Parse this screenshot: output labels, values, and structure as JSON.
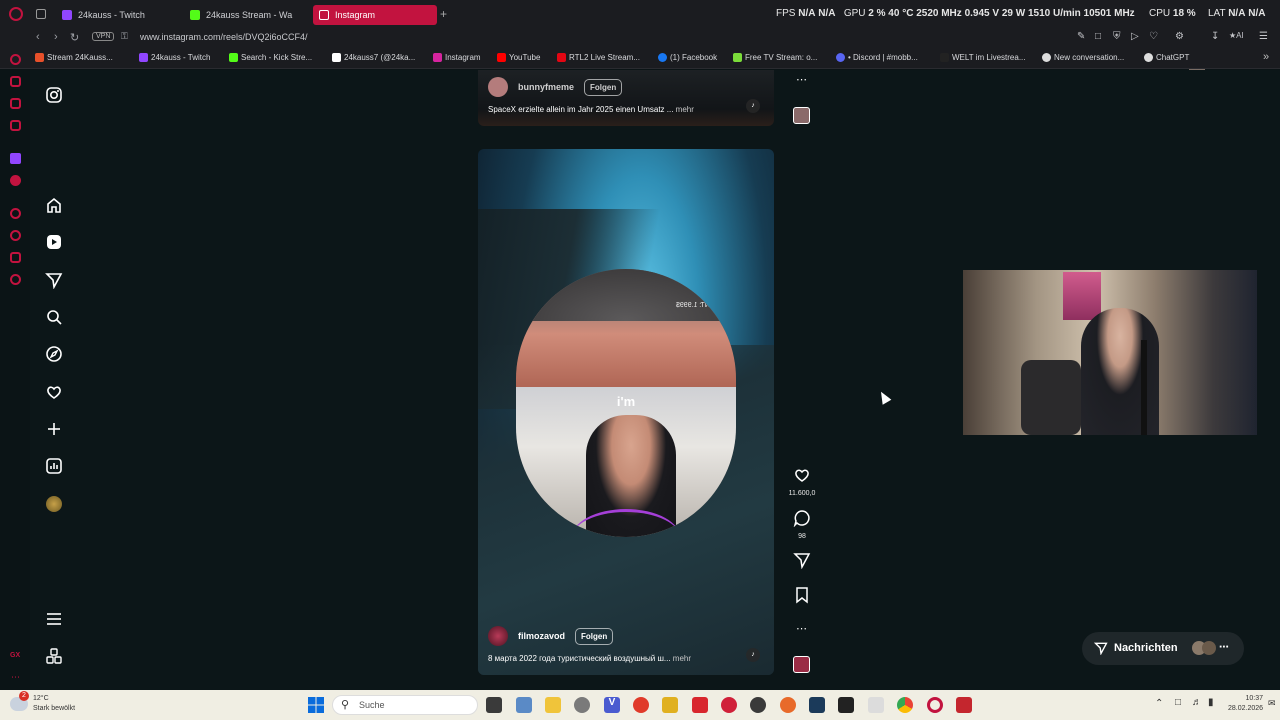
{
  "tabs": [
    {
      "label": "24kauss - Twitch",
      "icon": "twitch-icon",
      "color": "#9146ff"
    },
    {
      "label": "24kauss Stream - Wa",
      "icon": "kick-icon",
      "color": "#53fc18"
    },
    {
      "label": "Instagram",
      "icon": "instagram-icon",
      "color": "#ffffff",
      "active": true
    }
  ],
  "stats": {
    "fps_label": "FPS",
    "fps_value": "N/A",
    "fps_value2": "N/A",
    "gpu_label": "GPU",
    "gpu_load": "2 %",
    "gpu_temp": "40 °C",
    "gpu_clock": "2520 MHz",
    "gpu_volt": "0.945 V",
    "gpu_power": "29 W",
    "gpu_fan": "1510 U/min",
    "gpu_mem": "10501 MHz",
    "cpu_label": "CPU",
    "cpu_load": "18 %",
    "lat_label": "LAT",
    "lat_value": "N/A",
    "lat_value2": "N/A"
  },
  "address": {
    "vpn": "VPN",
    "url": "www.instagram.com/reels/DVQ2i6oCCF4/"
  },
  "bookmarks": [
    {
      "label": "Stream 24Kauss...",
      "color": "#e8502a"
    },
    {
      "label": "24kauss - Twitch",
      "color": "#9146ff"
    },
    {
      "label": "Search - Kick Stre...",
      "color": "#53fc18"
    },
    {
      "label": "24kauss7 (@24ka...",
      "color": "#ffffff"
    },
    {
      "label": "Instagram",
      "color": "#d6249f"
    },
    {
      "label": "YouTube",
      "color": "#ff0000"
    },
    {
      "label": "RTL2 Live Stream...",
      "color": "#e30613"
    },
    {
      "label": "(1) Facebook",
      "color": "#1877f2"
    },
    {
      "label": "Free TV Stream: o...",
      "color": "#7bdc3a"
    },
    {
      "label": "• Discord | #mobb...",
      "color": "#5865f2"
    },
    {
      "label": "WELT im Livestrea...",
      "color": "#222222"
    },
    {
      "label": "New conversation...",
      "color": "#dddddd"
    },
    {
      "label": "ChatGPT",
      "color": "#dddddd"
    }
  ],
  "reel_top": {
    "username": "bunnyfmeme",
    "follow": "Folgen",
    "caption": "SpaceX erzielte allein im Jahr 2025 einen Umsatz ...",
    "more": "mehr"
  },
  "reel_main": {
    "username": "filmozavod",
    "follow": "Folgen",
    "caption": "8 марта 2022 года туристический воздушный ш...",
    "more": "mehr",
    "overlay_word": "i'm",
    "mirror_text": "NT: 1.999$",
    "likes": "11.600,0",
    "comments": "98"
  },
  "messages": {
    "label": "Nachrichten"
  },
  "taskbar": {
    "weather_temp": "12°C",
    "weather_desc": "Stark bewölkt",
    "search_placeholder": "Suche",
    "time": "10:37",
    "date": "28.02.2026",
    "notif_count": "2"
  },
  "colors": {
    "accent": "#c2133f",
    "page_bg": "#0c1618",
    "taskbar": "#f0eee3"
  }
}
